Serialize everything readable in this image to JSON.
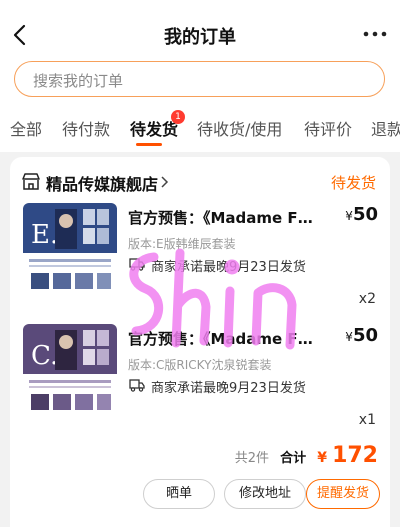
{
  "header": {
    "title": "我的订单"
  },
  "search": {
    "placeholder": "搜索我的订单"
  },
  "tabs": [
    {
      "label": "全部"
    },
    {
      "label": "待付款"
    },
    {
      "label": "待发货",
      "active": true,
      "badge": "1"
    },
    {
      "label": "待收货/使用"
    },
    {
      "label": "待评价"
    },
    {
      "label": "退款"
    }
  ],
  "order": {
    "store_name": "精品传媒旗舰店",
    "status": "待发货",
    "items": [
      {
        "title": "官方预售：《Madame Figaro》",
        "currency": "¥",
        "price": "50",
        "variant": "版本:E版韩维辰套装",
        "ship_promise": "商家承诺最晚9月23日发货",
        "qty": "x2",
        "thumb_letter": "E.",
        "thumb_color": "#2f4a86"
      },
      {
        "title": "官方预售：《Madame Figaro》",
        "currency": "¥",
        "price": "50",
        "variant": "版本:C版RICKY沈泉锐套装",
        "ship_promise": "商家承诺最晚9月23日发货",
        "qty": "x1",
        "thumb_letter": "C.",
        "thumb_color": "#5a4a7a"
      }
    ],
    "summary": {
      "count_text": "共2件",
      "total_label": "合计",
      "currency": "¥",
      "total": "172"
    },
    "actions": [
      {
        "label": "晒单"
      },
      {
        "label": "修改地址"
      },
      {
        "label": "提醒发货"
      }
    ]
  },
  "colors": {
    "accent": "#ff5000",
    "status": "#ff6a00",
    "badge": "#ff3b30",
    "watermark": "#f07ff0"
  }
}
